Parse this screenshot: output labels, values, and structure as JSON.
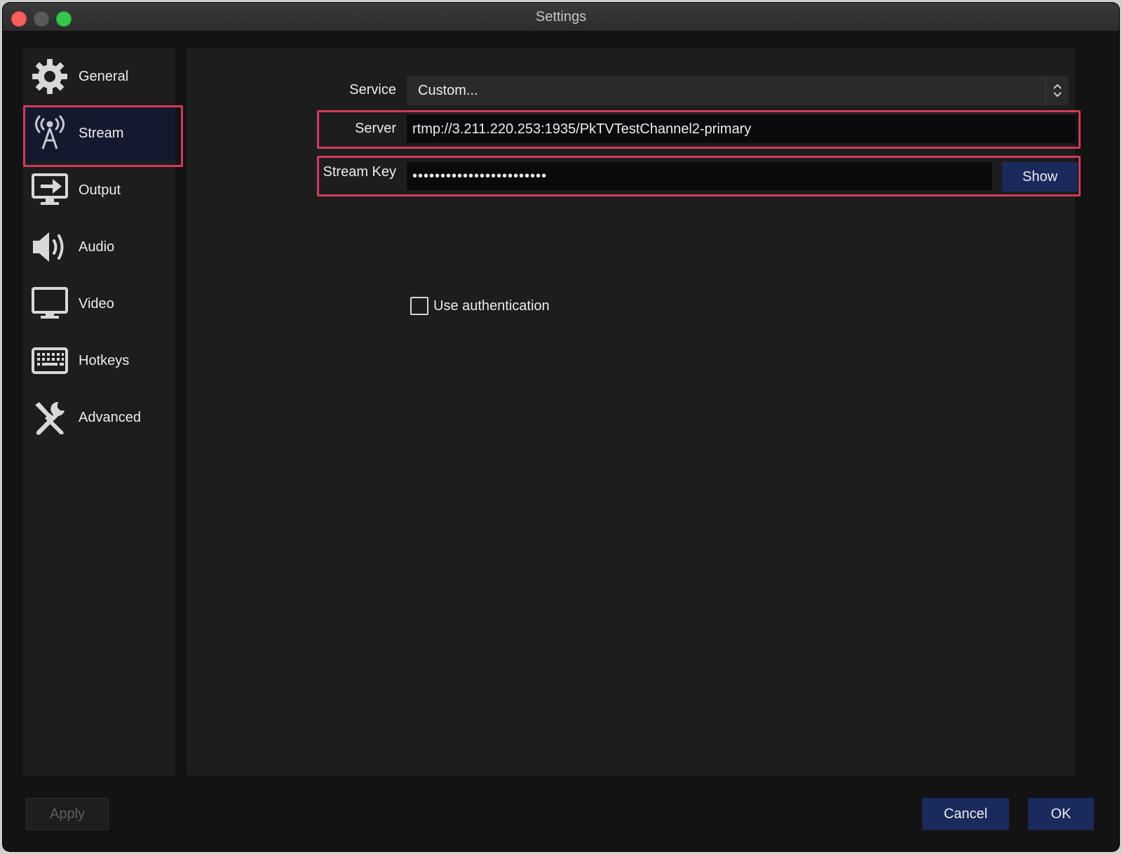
{
  "window": {
    "title": "Settings"
  },
  "sidebar": {
    "items": [
      {
        "label": "General",
        "icon": "gear-icon"
      },
      {
        "label": "Stream",
        "icon": "broadcast-tower-icon",
        "selected": true
      },
      {
        "label": "Output",
        "icon": "output-monitor-icon"
      },
      {
        "label": "Audio",
        "icon": "speaker-icon"
      },
      {
        "label": "Video",
        "icon": "monitor-icon"
      },
      {
        "label": "Hotkeys",
        "icon": "keyboard-icon"
      },
      {
        "label": "Advanced",
        "icon": "tools-icon"
      }
    ]
  },
  "stream": {
    "service_label": "Service",
    "service_value": "Custom...",
    "server_label": "Server",
    "server_value": "rtmp://3.211.220.253:1935/PkTVTestChannel2-primary",
    "stream_key_label": "Stream Key",
    "stream_key_value": "••••••••••••••••••••••••",
    "show_label": "Show",
    "use_auth_label": "Use authentication",
    "use_auth_checked": false
  },
  "footer": {
    "apply_label": "Apply",
    "cancel_label": "Cancel",
    "ok_label": "OK"
  },
  "colors": {
    "accent_button": "#1b2a5c",
    "highlight": "#d23a5a",
    "selected_item": "#131a2f"
  }
}
